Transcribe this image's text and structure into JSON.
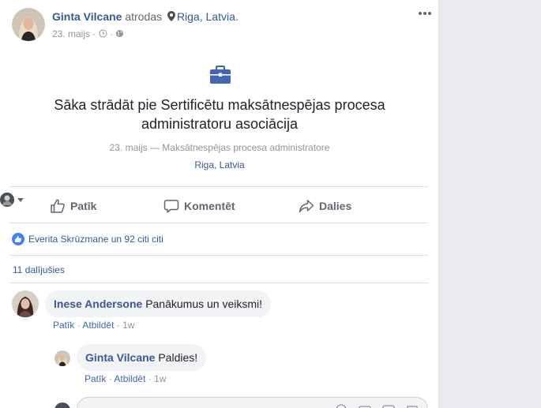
{
  "post": {
    "author": "Ginta Vilcane",
    "verb": "atrodas",
    "place": "Riga, Latvia.",
    "date": "23. maijs",
    "meta_sep": " · "
  },
  "event": {
    "title": "Sāka strādāt pie Sertificētu maksātnespējas procesa administratoru asociācija",
    "sub": "23. maijs — Maksātnespējas procesa administratore",
    "location": "Riga, Latvia"
  },
  "actions": {
    "like": "Patīk",
    "comment": "Komentēt",
    "share": "Dalies"
  },
  "reactions": {
    "text": "Everita Skrūzmane un 92 citi citi"
  },
  "shares": {
    "text": "11 dalījušies"
  },
  "comments": [
    {
      "author": "Inese Andersone",
      "text": "Panākumus un veiksmi!",
      "like": "Patīk",
      "reply": "Atbildēt",
      "time": "1w"
    },
    {
      "author": "Ginta Vilcane",
      "text": "Paldies!",
      "like": "Patīk",
      "reply": "Atbildēt",
      "time": "1w"
    }
  ],
  "colors": {
    "link": "#365899",
    "brand": "#4267b2",
    "muted": "#90949c",
    "badge": "#4080ff"
  }
}
